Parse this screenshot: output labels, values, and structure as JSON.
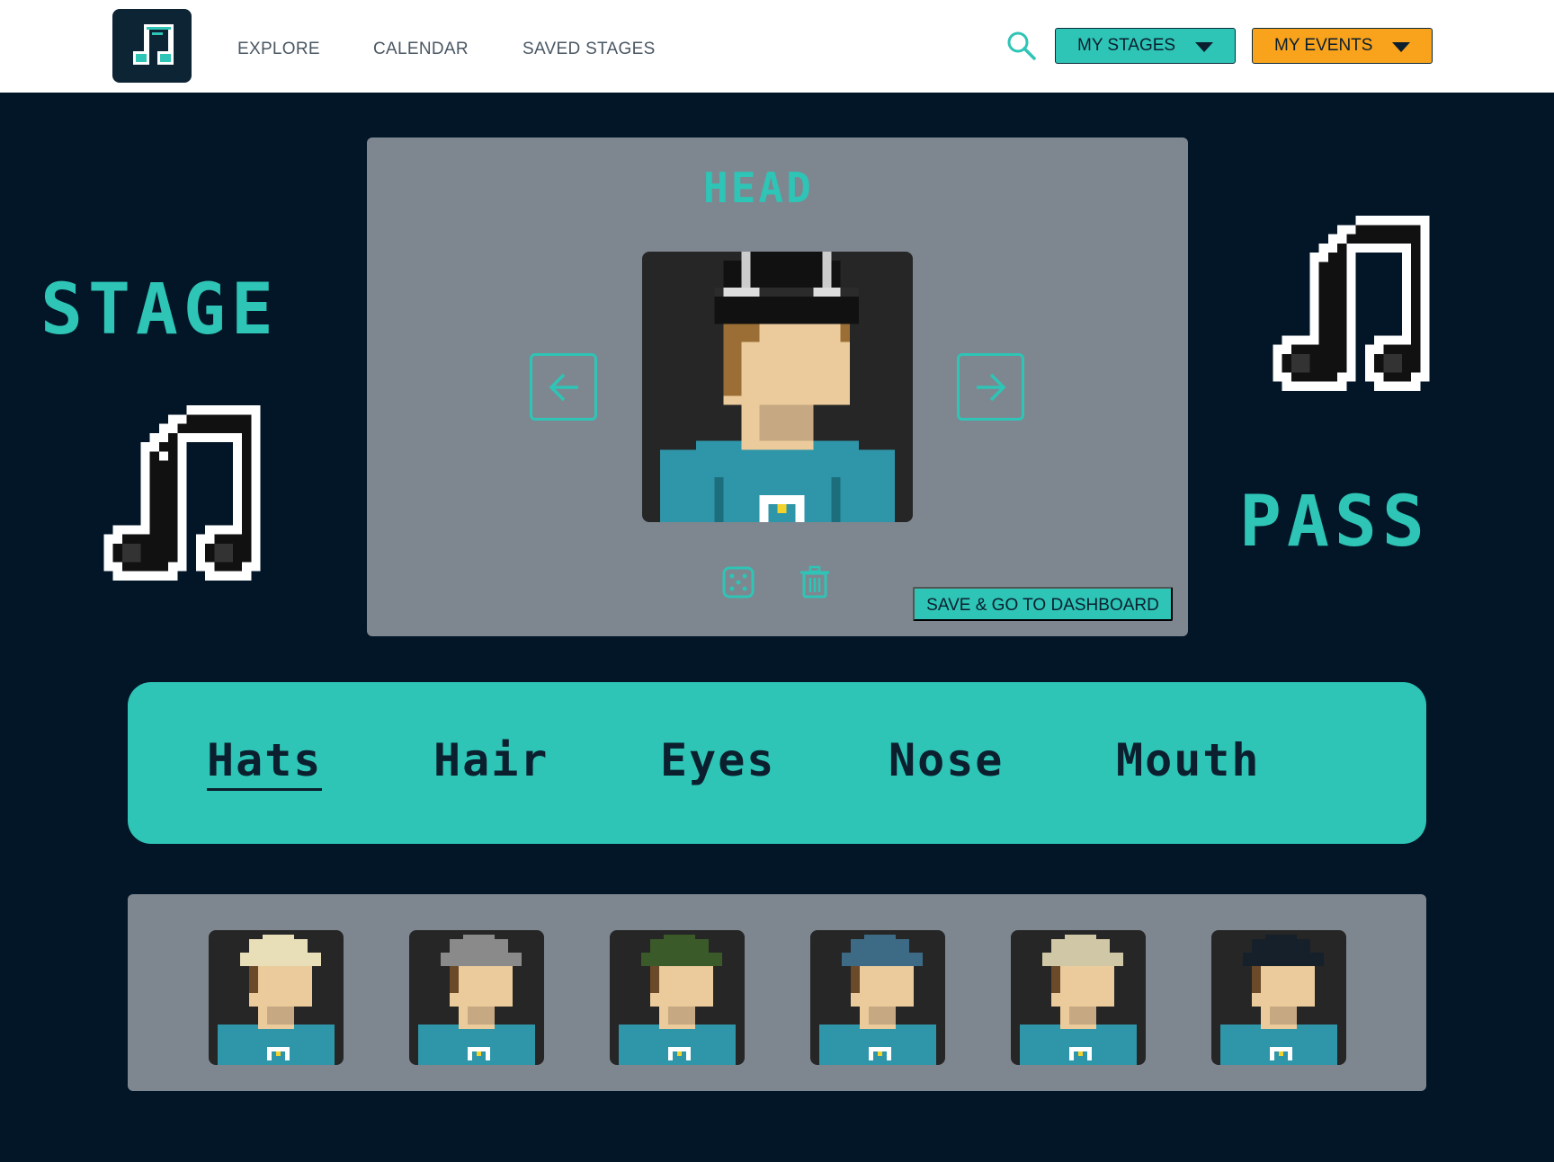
{
  "nav": {
    "links": [
      "EXPLORE",
      "CALENDAR",
      "SAVED STAGES"
    ],
    "search_icon": "search-icon",
    "my_stages_label": "MY STAGES",
    "my_events_label": "MY EVENTS"
  },
  "branding": {
    "title_left": "STAGE",
    "title_right": "PASS",
    "logo_icon": "music-note-icon"
  },
  "editor": {
    "section_title": "HEAD",
    "prev_icon": "arrow-left-icon",
    "next_icon": "arrow-right-icon",
    "randomize_icon": "dice-icon",
    "delete_icon": "trash-icon",
    "save_label": "SAVE & GO TO DASHBOARD"
  },
  "categories": {
    "tabs": [
      "Hats",
      "Hair",
      "Eyes",
      "Nose",
      "Mouth"
    ],
    "active": "Hats"
  },
  "options": {
    "items": [
      {
        "name": "straw-hat",
        "color": "#e8dfb8"
      },
      {
        "name": "gray-beanie",
        "color": "#8a8a8a"
      },
      {
        "name": "green-cap",
        "color": "#3b5a2a"
      },
      {
        "name": "blue-cap",
        "color": "#3d6a85"
      },
      {
        "name": "beige-cap",
        "color": "#cfc7a5"
      },
      {
        "name": "black-bucket-hat",
        "color": "#15202a"
      }
    ]
  },
  "colors": {
    "accent": "#2ec4b6",
    "orange": "#f9a21b",
    "background": "#021627",
    "panel": "#7e8790",
    "skin": "#ebcb9b",
    "shirt": "#2f95a8"
  }
}
